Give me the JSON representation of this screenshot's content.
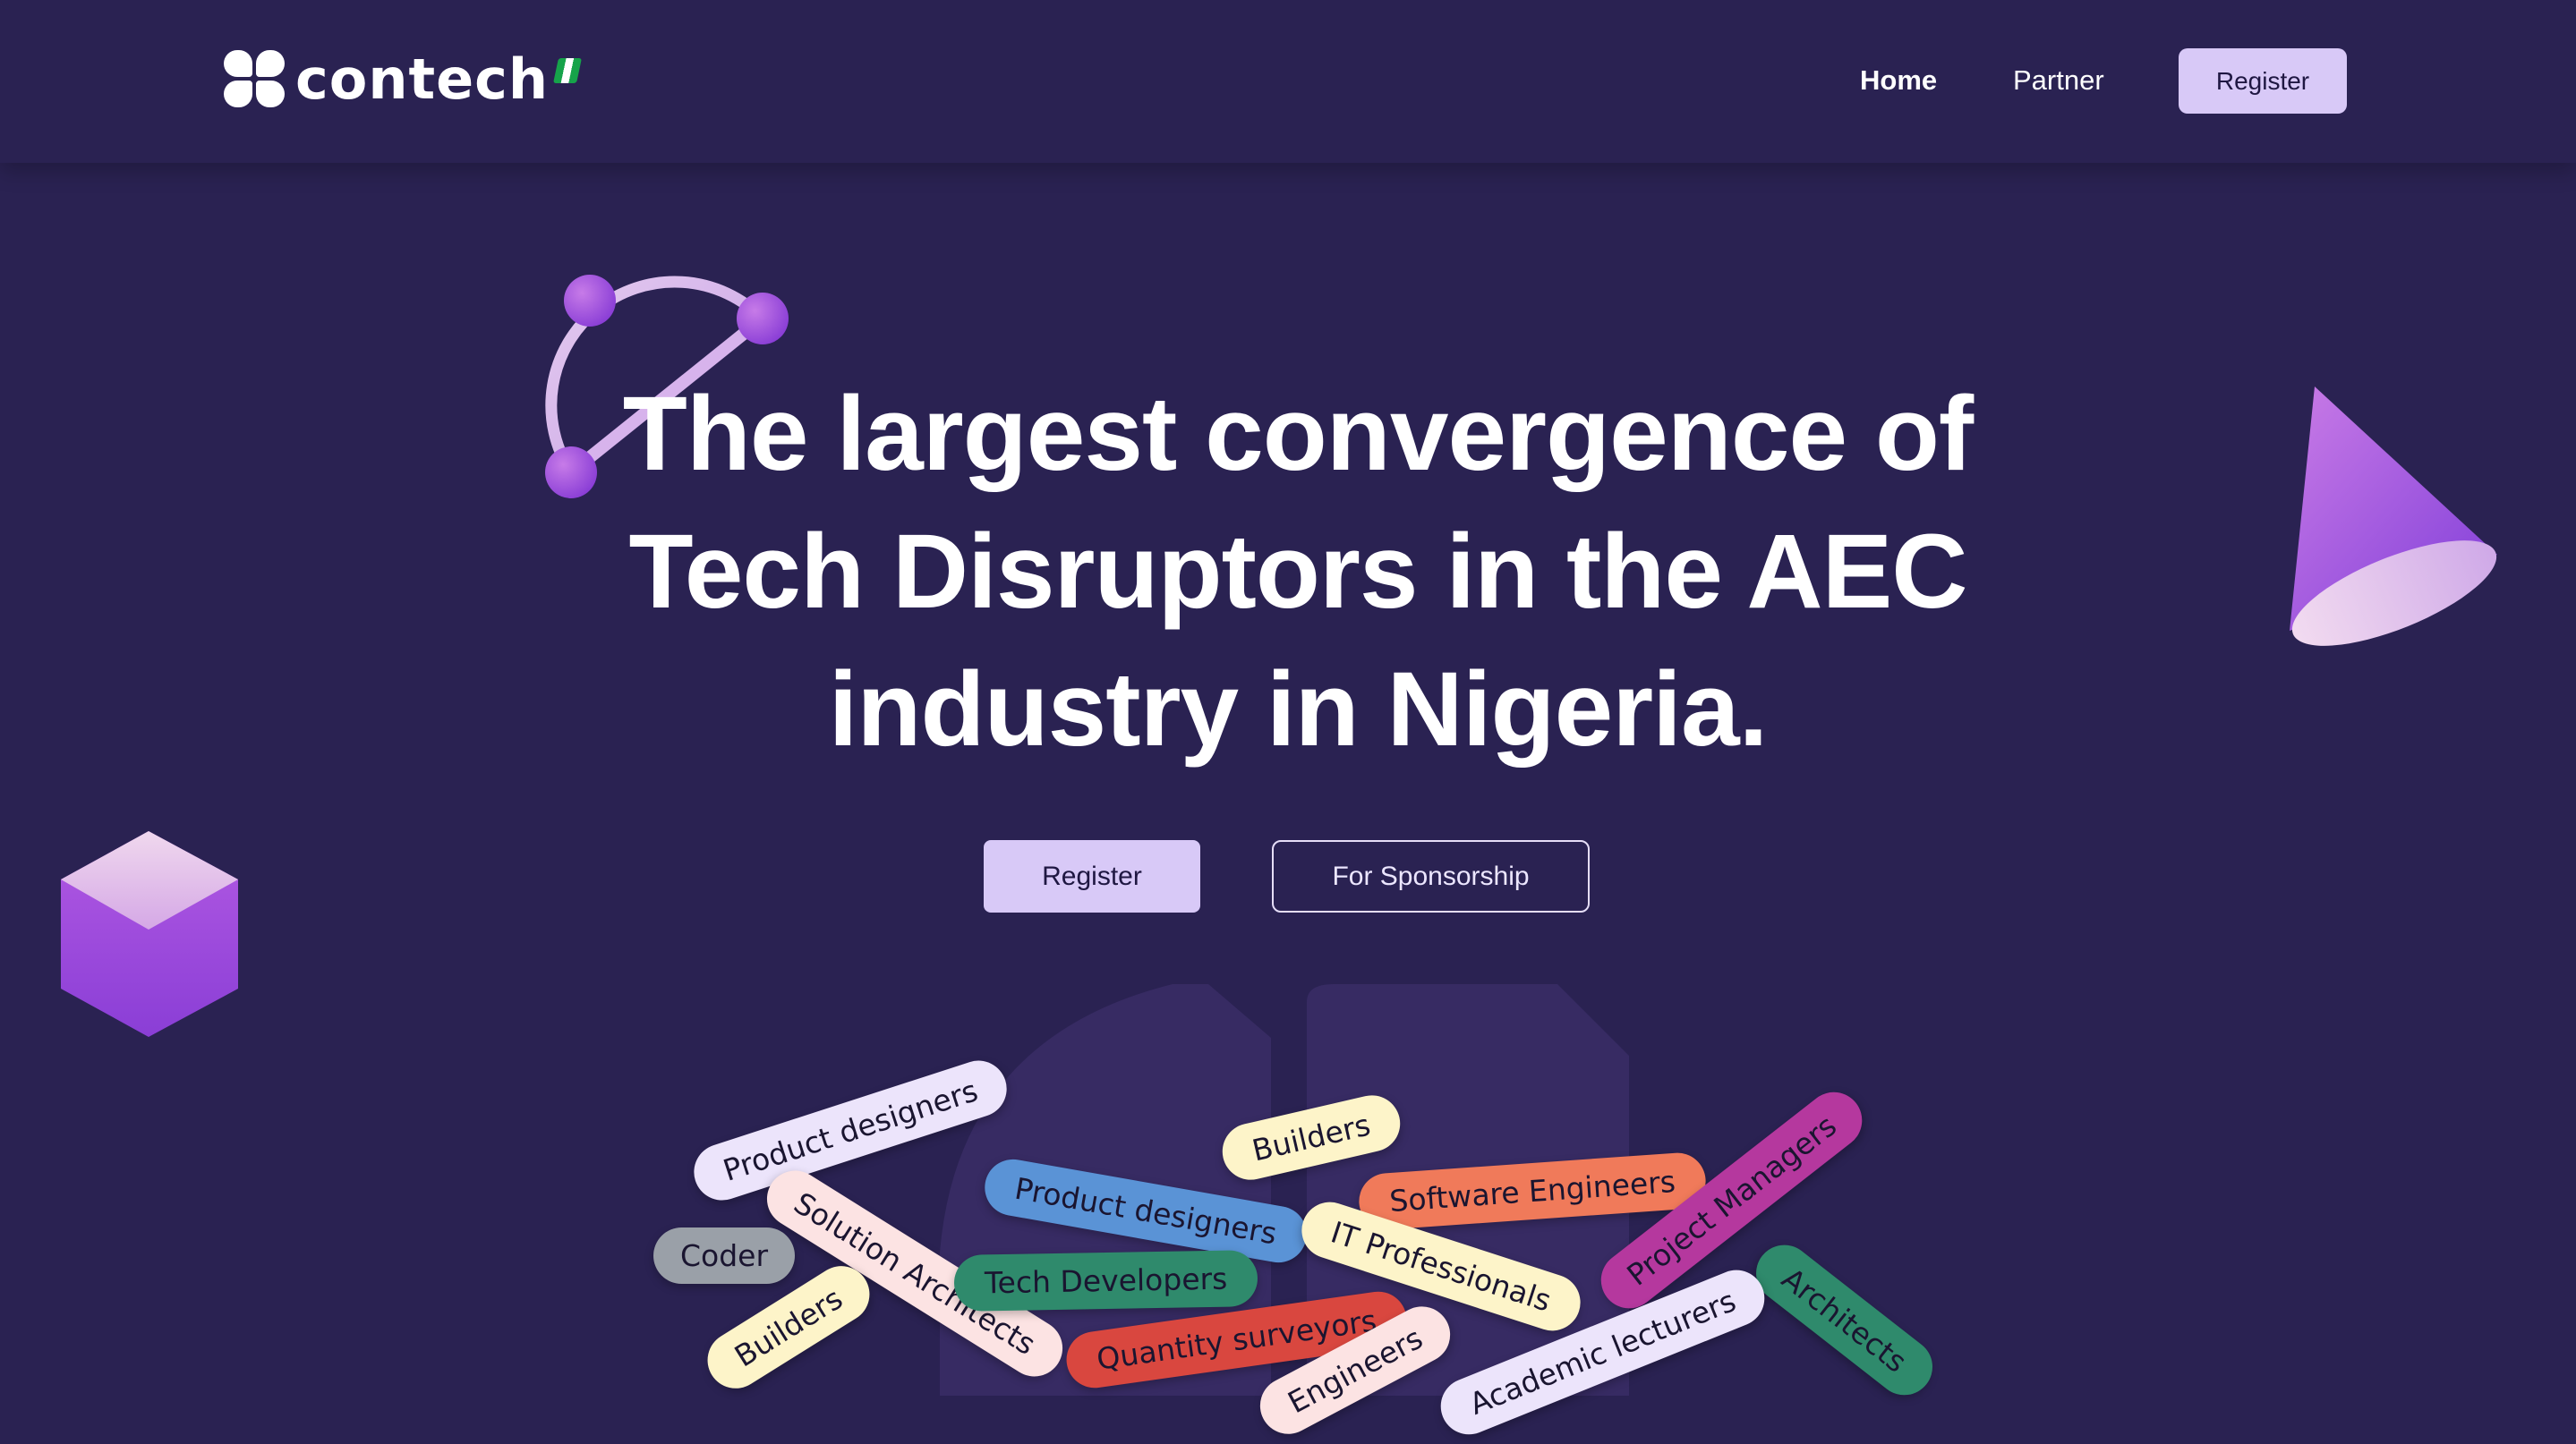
{
  "header": {
    "logo_text": "contech",
    "nav": {
      "home": "Home",
      "partner": "Partner",
      "register": "Register"
    }
  },
  "hero": {
    "title_lines": [
      "The largest convergence of",
      "Tech Disruptors in the AEC",
      "industry in Nigeria."
    ],
    "register_label": "Register",
    "sponsorship_label": "For Sponsorship"
  },
  "tags": [
    {
      "label": "Product designers",
      "color": "#ece4fb"
    },
    {
      "label": "Builders",
      "color": "#fdf4c9"
    },
    {
      "label": "Software Engineers",
      "color": "#f07a5a"
    },
    {
      "label": "Project Managers",
      "color": "#b5389e"
    },
    {
      "label": "Product designers",
      "color": "#5a93d6"
    },
    {
      "label": "Solution Architects",
      "color": "#fce3e3"
    },
    {
      "label": "IT Professionals",
      "color": "#fdf4c9"
    },
    {
      "label": "Coder",
      "color": "#9aa0a8"
    },
    {
      "label": "Tech Developers",
      "color": "#2f8a6c"
    },
    {
      "label": "Architects",
      "color": "#2f8a6c"
    },
    {
      "label": "Builders",
      "color": "#fdf4c9"
    },
    {
      "label": "Quantity surveyors",
      "color": "#d9473f"
    },
    {
      "label": "Engineers",
      "color": "#fce3e3"
    },
    {
      "label": "Academic lecturers",
      "color": "#ece4fb"
    }
  ],
  "colors": {
    "background": "#2a2252",
    "accent": "#d8c9f7",
    "shape_purple": "#9b4fe0"
  }
}
